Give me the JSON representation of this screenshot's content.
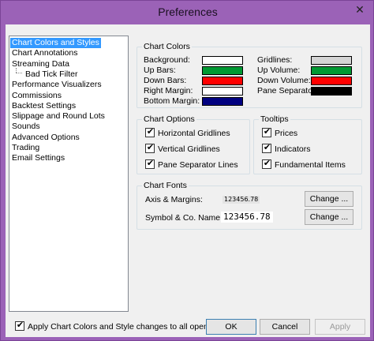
{
  "window": {
    "title": "Preferences",
    "close_glyph": "✕"
  },
  "tree": {
    "items": [
      {
        "label": "Chart Colors and Styles",
        "selected": true
      },
      {
        "label": "Chart Annotations"
      },
      {
        "label": "Streaming Data"
      },
      {
        "label": "Bad Tick Filter",
        "child": true
      },
      {
        "label": "Performance Visualizers"
      },
      {
        "label": "Commissions"
      },
      {
        "label": "Backtest Settings"
      },
      {
        "label": "Slippage and Round Lots"
      },
      {
        "label": "Sounds"
      },
      {
        "label": "Advanced Options"
      },
      {
        "label": "Trading"
      },
      {
        "label": "Email Settings"
      }
    ]
  },
  "chart_colors": {
    "title": "Chart Colors",
    "left": [
      {
        "label": "Background:",
        "color": "#ffffff"
      },
      {
        "label": "Up Bars:",
        "color": "#009933"
      },
      {
        "label": "Down Bars:",
        "color": "#ff0000"
      },
      {
        "label": "Right Margin:",
        "color": "#ffffff"
      },
      {
        "label": "Bottom Margin:",
        "color": "#000080"
      }
    ],
    "right": [
      {
        "label": "Gridlines:",
        "color": "#d4d4d4"
      },
      {
        "label": "Up Volume:",
        "color": "#009933"
      },
      {
        "label": "Down Volume:",
        "color": "#ff0000"
      },
      {
        "label": "Pane Separator:",
        "color": "#000000"
      }
    ]
  },
  "chart_options": {
    "title": "Chart Options",
    "items": [
      {
        "label": "Horizontal Gridlines",
        "checked": true
      },
      {
        "label": "Vertical Gridlines",
        "checked": true
      },
      {
        "label": "Pane Separator Lines",
        "checked": true
      }
    ]
  },
  "tooltips": {
    "title": "Tooltips",
    "items": [
      {
        "label": "Prices",
        "checked": true
      },
      {
        "label": "Indicators",
        "checked": true
      },
      {
        "label": "Fundamental Items",
        "checked": true
      }
    ]
  },
  "chart_fonts": {
    "title": "Chart Fonts",
    "axis_label": "Axis & Margins:",
    "axis_sample": "123456.78",
    "axis_button": "Change ...",
    "symbol_label": "Symbol & Co. Name:",
    "symbol_sample": "123456.78",
    "symbol_button": "Change ..."
  },
  "footer": {
    "apply_all_label": "Apply Chart Colors and Style changes to all open Charts",
    "apply_all_checked": true,
    "ok": "OK",
    "cancel": "Cancel",
    "apply": "Apply"
  }
}
